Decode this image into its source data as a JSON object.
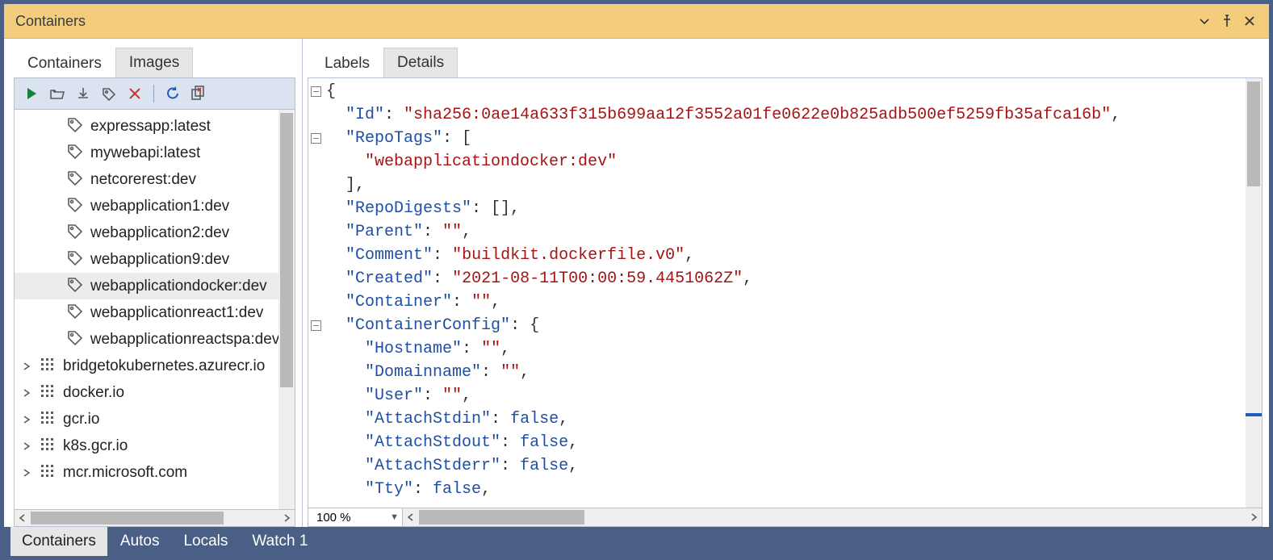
{
  "window": {
    "title": "Containers"
  },
  "leftTabs": {
    "containers": "Containers",
    "images": "Images",
    "selected": "images"
  },
  "rightTabs": {
    "labels": "Labels",
    "details": "Details",
    "selected": "details"
  },
  "zoom": {
    "level": "100 %"
  },
  "bottomTabs": {
    "items": [
      "Containers",
      "Autos",
      "Locals",
      "Watch 1"
    ],
    "selected": 0
  },
  "tree": {
    "selectedIndex": 6,
    "items": [
      {
        "kind": "image",
        "label": "expressapp:latest"
      },
      {
        "kind": "image",
        "label": "mywebapi:latest"
      },
      {
        "kind": "image",
        "label": "netcorerest:dev"
      },
      {
        "kind": "image",
        "label": "webapplication1:dev"
      },
      {
        "kind": "image",
        "label": "webapplication2:dev"
      },
      {
        "kind": "image",
        "label": "webapplication9:dev"
      },
      {
        "kind": "image",
        "label": "webapplicationdocker:dev"
      },
      {
        "kind": "image",
        "label": "webapplicationreact1:dev"
      },
      {
        "kind": "image",
        "label": "webapplicationreactspa:dev"
      },
      {
        "kind": "registry",
        "label": "bridgetokubernetes.azurecr.io",
        "expandable": true
      },
      {
        "kind": "registry",
        "label": "docker.io",
        "expandable": true
      },
      {
        "kind": "registry",
        "label": "gcr.io",
        "expandable": true
      },
      {
        "kind": "registry",
        "label": "k8s.gcr.io",
        "expandable": true
      },
      {
        "kind": "registry",
        "label": "mcr.microsoft.com",
        "expandable": true
      }
    ]
  },
  "editor": {
    "folds": [
      {
        "line": 0,
        "open": true
      },
      {
        "line": 2,
        "open": true
      },
      {
        "line": 12,
        "open": true
      }
    ],
    "lines": [
      {
        "t": "punct",
        "text": "{"
      },
      {
        "t": "kv",
        "indent": 1,
        "key": "Id",
        "valType": "string",
        "val": "sha256:0ae14a633f315b699aa12f3552a01fe0622e0b825adb500ef5259fb35afca16b",
        "comma": true
      },
      {
        "t": "kopen",
        "indent": 1,
        "key": "RepoTags",
        "open": "["
      },
      {
        "t": "str",
        "indent": 2,
        "val": "webapplicationdocker:dev"
      },
      {
        "t": "close",
        "indent": 1,
        "close": "]",
        "comma": true
      },
      {
        "t": "kv",
        "indent": 1,
        "key": "RepoDigests",
        "valType": "raw",
        "val": "[]",
        "comma": true
      },
      {
        "t": "kv",
        "indent": 1,
        "key": "Parent",
        "valType": "string",
        "val": "",
        "comma": true
      },
      {
        "t": "kv",
        "indent": 1,
        "key": "Comment",
        "valType": "string",
        "val": "buildkit.dockerfile.v0",
        "comma": true
      },
      {
        "t": "kv",
        "indent": 1,
        "key": "Created",
        "valType": "string",
        "val": "2021-08-11T00:00:59.4451062Z",
        "comma": true
      },
      {
        "t": "kv",
        "indent": 1,
        "key": "Container",
        "valType": "string",
        "val": "",
        "comma": true
      },
      {
        "t": "kopen",
        "indent": 1,
        "key": "ContainerConfig",
        "open": "{"
      },
      {
        "t": "kv",
        "indent": 2,
        "key": "Hostname",
        "valType": "string",
        "val": "",
        "comma": true
      },
      {
        "t": "kv",
        "indent": 2,
        "key": "Domainname",
        "valType": "string",
        "val": "",
        "comma": true
      },
      {
        "t": "kv",
        "indent": 2,
        "key": "User",
        "valType": "string",
        "val": "",
        "comma": true
      },
      {
        "t": "kv",
        "indent": 2,
        "key": "AttachStdin",
        "valType": "bool",
        "val": "false",
        "comma": true
      },
      {
        "t": "kv",
        "indent": 2,
        "key": "AttachStdout",
        "valType": "bool",
        "val": "false",
        "comma": true
      },
      {
        "t": "kv",
        "indent": 2,
        "key": "AttachStderr",
        "valType": "bool",
        "val": "false",
        "comma": true
      },
      {
        "t": "kv",
        "indent": 2,
        "key": "Tty",
        "valType": "bool",
        "val": "false",
        "comma": true,
        "partial": true
      }
    ]
  }
}
